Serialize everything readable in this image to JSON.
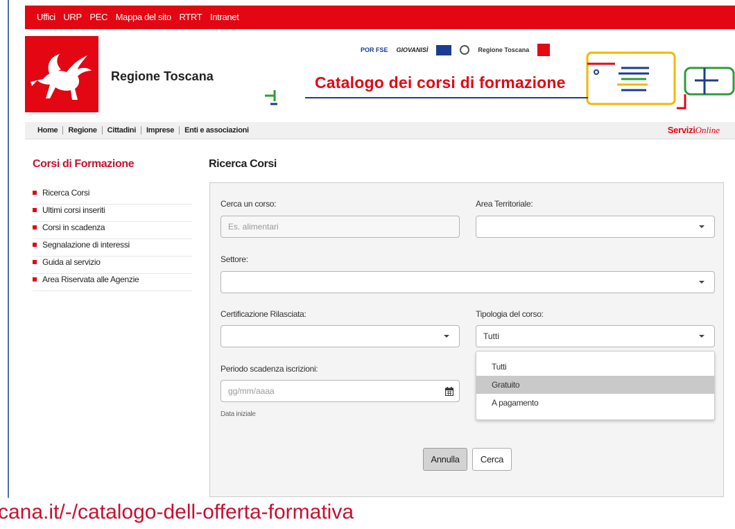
{
  "topbar": {
    "links": [
      "Uffici",
      "URP",
      "PEC",
      "Mappa del sito",
      "RTRT",
      "Intranet"
    ]
  },
  "header": {
    "org_name": "Regione Toscana",
    "catalog_title": "Catalogo dei corsi di formazione",
    "sponsors": [
      "POR FSE",
      "GIOVANISÌ",
      "Regione Toscana"
    ]
  },
  "navbar": {
    "items": [
      "Home",
      "Regione",
      "Cittadini",
      "Imprese",
      "Enti e associazioni"
    ],
    "servizi_bold": "Servizi",
    "servizi_italic": "Online"
  },
  "sidebar": {
    "title": "Corsi di Formazione",
    "items": [
      "Ricerca Corsi",
      "Ultimi corsi inseriti",
      "Corsi in scadenza",
      "Segnalazione di interessi",
      "Guida al servizio",
      "Area Riservata alle Agenzie"
    ]
  },
  "main": {
    "title": "Ricerca Corsi",
    "search_label": "Cerca un corso:",
    "search_placeholder": "Es. alimentari",
    "area_label": "Area Territoriale:",
    "area_value": "",
    "settore_label": "Settore:",
    "settore_value": "",
    "cert_label": "Certificazione Rilasciata:",
    "cert_value": "",
    "tipologia_label": "Tipologia del corso:",
    "tipologia_value": "Tutti",
    "tipologia_options": [
      "Tutti",
      "Gratuito",
      "A pagamento"
    ],
    "tipologia_highlighted": "Gratuito",
    "periodo_label": "Periodo scadenza iscrizioni:",
    "date_placeholder": "gg/mm/aaaa",
    "date_hint": "Data iniziale",
    "btn_annulla": "Annulla",
    "btn_cerca": "Cerca"
  },
  "footer_url": "cana.it/-/catalogo-dell-offerta-formativa",
  "colors": {
    "brand_red": "#e30613",
    "title_red": "#c8102e",
    "accent_blue": "#1a3d8f"
  }
}
